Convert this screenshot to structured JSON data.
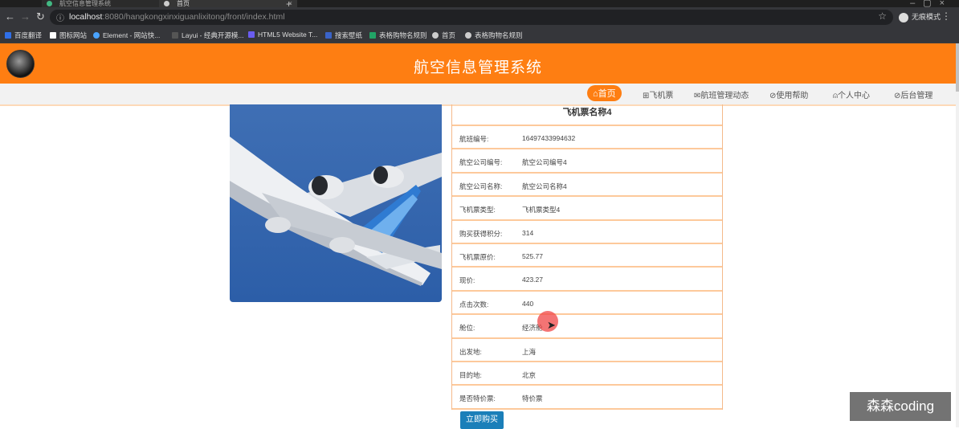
{
  "browser": {
    "tabs": [
      {
        "title": "航空信息管理系统",
        "active": false
      },
      {
        "title": "首页",
        "active": true
      }
    ],
    "url_host": "localhost",
    "url_rest": ":8080/hangkongxinxiguanlixitong/front/index.html",
    "profile_label": "无痕模式",
    "bookmarks": [
      "百度翻译",
      "图标网站",
      "Element - 网站快...",
      "Layui - 经典开源模...",
      "HTML5 Website T...",
      "搜索壁纸",
      "表格购物名规则",
      "首页",
      "表格购物名规则"
    ]
  },
  "header": {
    "title": "航空信息管理系统"
  },
  "nav": [
    {
      "label": "⌂首页",
      "active": true
    },
    {
      "label": "⊞飞机票",
      "active": false
    },
    {
      "label": "✉航班管理动态",
      "active": false
    },
    {
      "label": "⊘使用帮助",
      "active": false
    },
    {
      "label": "⍝个人中心",
      "active": false
    },
    {
      "label": "⊘后台管理",
      "active": false
    }
  ],
  "detail": {
    "title": "飞机票名称4",
    "rows": [
      {
        "label": "航班编号:",
        "value": "16497433994632"
      },
      {
        "label": "航空公司编号:",
        "value": "航空公司编号4"
      },
      {
        "label": "航空公司名称:",
        "value": "航空公司名称4"
      },
      {
        "label": "飞机票类型:",
        "value": "飞机票类型4"
      },
      {
        "label": "购买获得积分:",
        "value": "314"
      },
      {
        "label": "飞机票原价:",
        "value": "525.77"
      },
      {
        "label": "现价:",
        "value": "423.27"
      },
      {
        "label": "点击次数:",
        "value": "440"
      },
      {
        "label": "舱位:",
        "value": "经济舱"
      },
      {
        "label": "出发地:",
        "value": "上海"
      },
      {
        "label": "目的地:",
        "value": "北京"
      },
      {
        "label": "是否特价票:",
        "value": "特价票"
      }
    ],
    "buy_label": "立即购买"
  },
  "watermark": "森森coding",
  "colors": {
    "brand": "#fe7e12",
    "button": "#1b7fb9",
    "row_border": "#fdc99b"
  }
}
